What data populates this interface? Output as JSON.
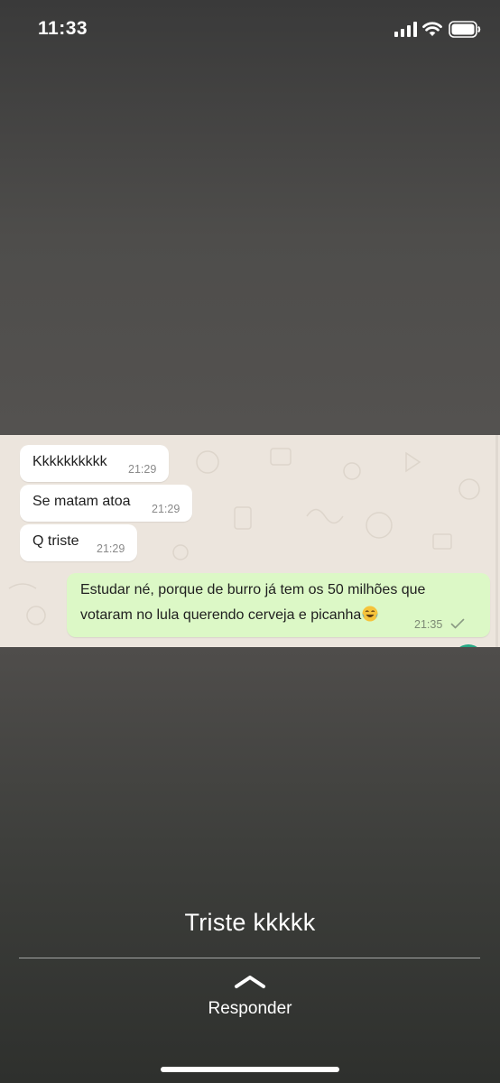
{
  "status_bar": {
    "time": "11:33",
    "icons": [
      "signal-icon",
      "wifi-icon",
      "battery-icon"
    ]
  },
  "chat": {
    "messages": [
      {
        "direction": "incoming",
        "text": "Kkkkkkkkkk",
        "time": "21:29"
      },
      {
        "direction": "incoming",
        "text": "Se matam atoa",
        "time": "21:29"
      },
      {
        "direction": "incoming",
        "text": "Q triste",
        "time": "21:29"
      },
      {
        "direction": "outgoing",
        "line1": "Estudar né, porque de burro já tem os 50  milhões  que",
        "line2": "votaram no lula querendo cerveja e picanha",
        "emoji": "face-with-tears-of-joy-icon",
        "time": "21:35",
        "status": "sent-check-icon"
      }
    ],
    "colors": {
      "background": "#ece5dd",
      "incoming_bubble": "#ffffff",
      "outgoing_bubble": "#dcf8c6",
      "scroll_button": "#25a884"
    }
  },
  "caption": "Triste kkkkk",
  "reply": {
    "icon": "chevron-up-icon",
    "label": "Responder"
  }
}
